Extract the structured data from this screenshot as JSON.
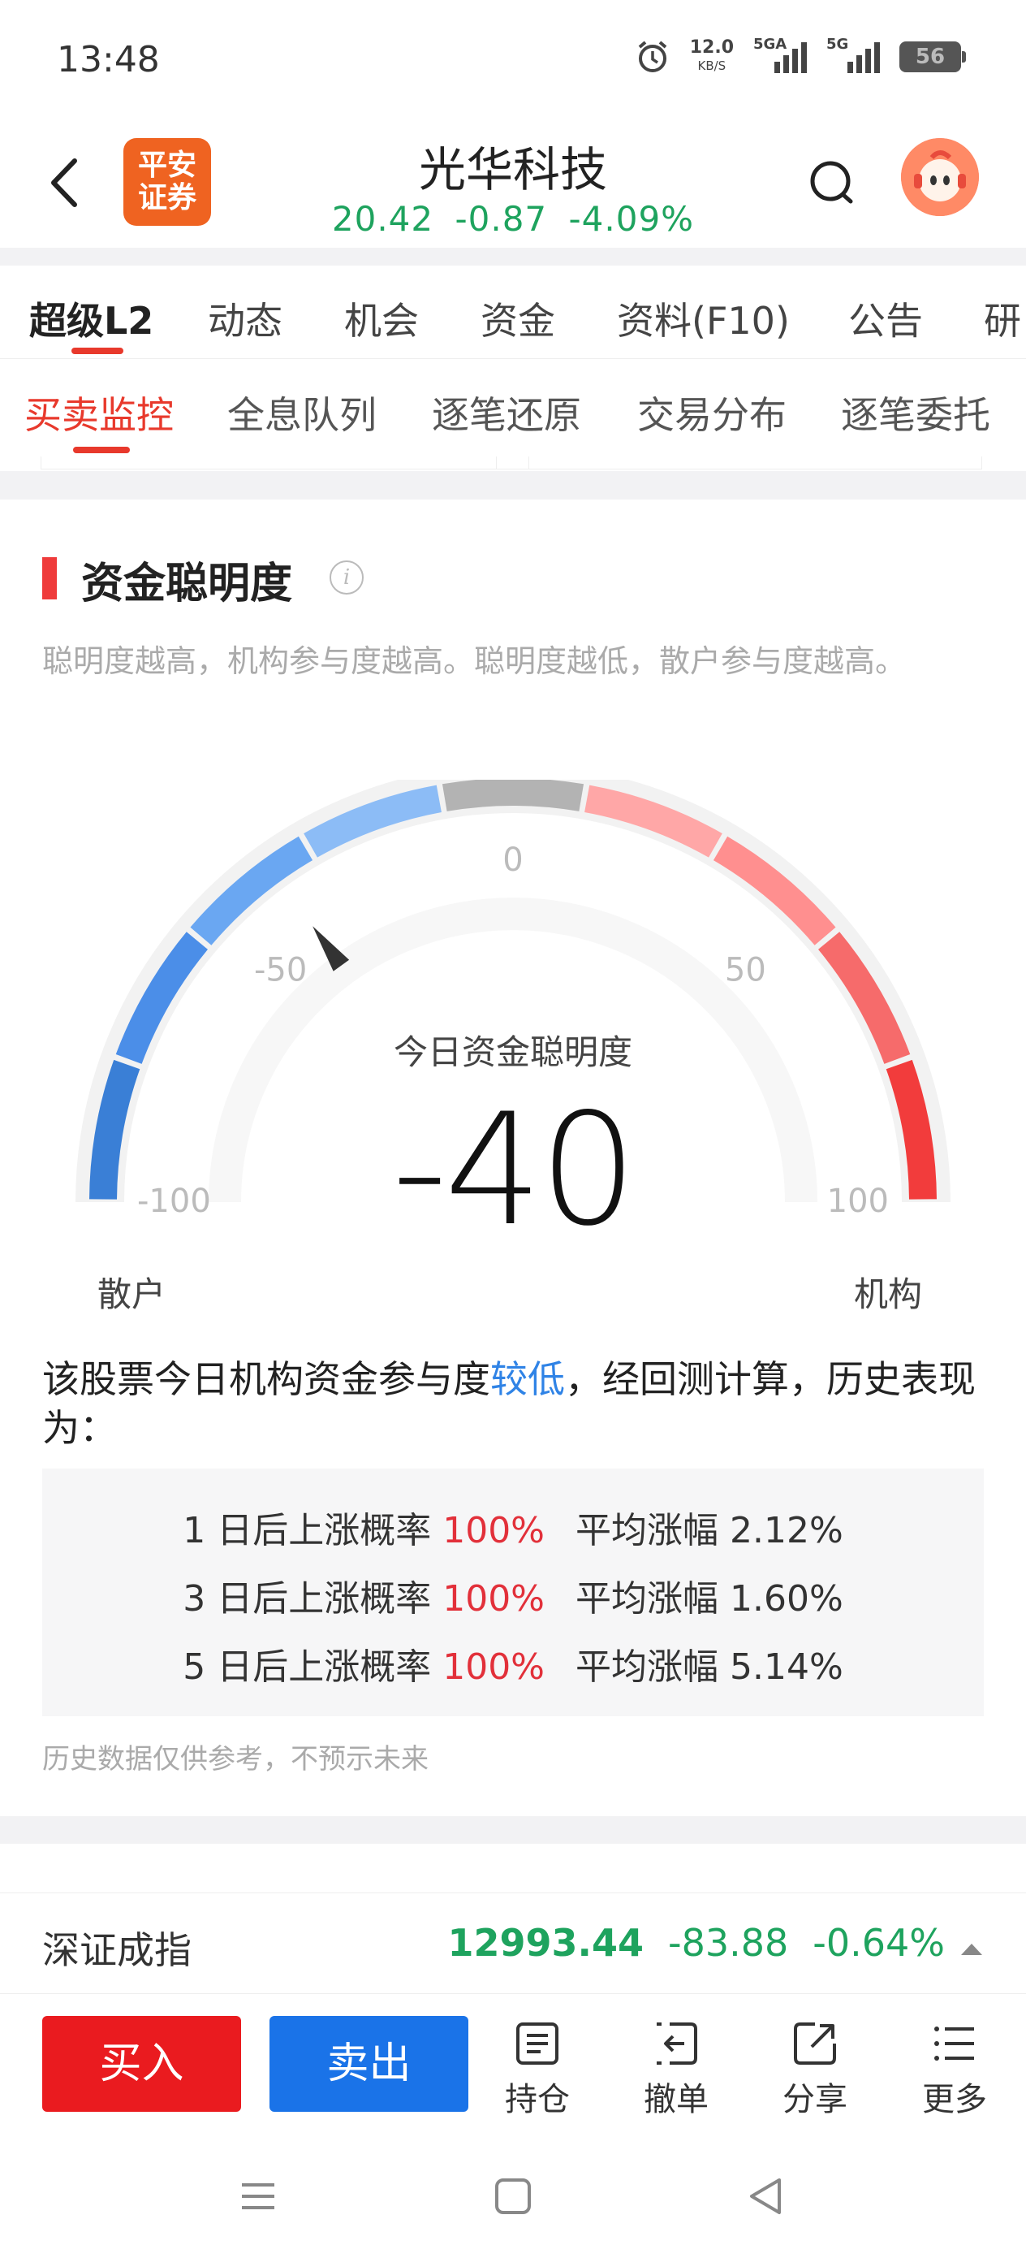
{
  "status_bar": {
    "time": "13:48",
    "net_speed": "12.0",
    "net_unit": "KB/S",
    "sig1_label": "5GA",
    "sig2_label": "5G",
    "battery": "56"
  },
  "header": {
    "logo_line1": "平安",
    "logo_line2": "证券",
    "title": "光华科技",
    "price": "20.42",
    "change": "-0.87",
    "change_pct": "-4.09%",
    "quote_color": "#1ea35e"
  },
  "tabs": [
    "超级L2",
    "动态",
    "机会",
    "资金",
    "资料(F10)",
    "公告",
    "研"
  ],
  "subtabs": [
    "买卖监控",
    "全息队列",
    "逐笔还原",
    "交易分布",
    "逐笔委托"
  ],
  "section": {
    "title": "资金聪明度",
    "description": "聪明度越高，机构参与度越高。聪明度越低，散户参与度越高。"
  },
  "gauge": {
    "value": -40,
    "value_text": "-40",
    "center_label": "今日资金聪明度",
    "ticks": [
      "-100",
      "-50",
      "0",
      "50",
      "100"
    ],
    "left_label": "散户",
    "right_label": "机构",
    "min": -100,
    "max": 100
  },
  "summary": {
    "prefix": "该股票今日机构资金参与度",
    "level": "较低",
    "suffix": "，经回测计算，历史表现为："
  },
  "stats": [
    {
      "days": "1 日后上涨概率",
      "prob": "100%",
      "avg_label": "平均涨幅",
      "avg": "2.12%"
    },
    {
      "days": "3 日后上涨概率",
      "prob": "100%",
      "avg_label": "平均涨幅",
      "avg": "1.60%"
    },
    {
      "days": "5 日后上涨概率",
      "prob": "100%",
      "avg_label": "平均涨幅",
      "avg": "5.14%"
    }
  ],
  "footnote": "历史数据仅供参考，不预示未来",
  "index_bar": {
    "name": "深证成指",
    "value": "12993.44",
    "change": "-83.88",
    "change_pct": "-0.64%"
  },
  "toolbar": {
    "buy": "买入",
    "sell": "卖出",
    "positions": "持仓",
    "cancel": "撤单",
    "share": "分享",
    "more": "更多"
  },
  "colors": {
    "accent_red": "#e8392c",
    "down_green": "#1ea35e",
    "link_blue": "#2f83e6",
    "buy_red": "#ea1b1f",
    "sell_blue": "#1a73e8"
  }
}
